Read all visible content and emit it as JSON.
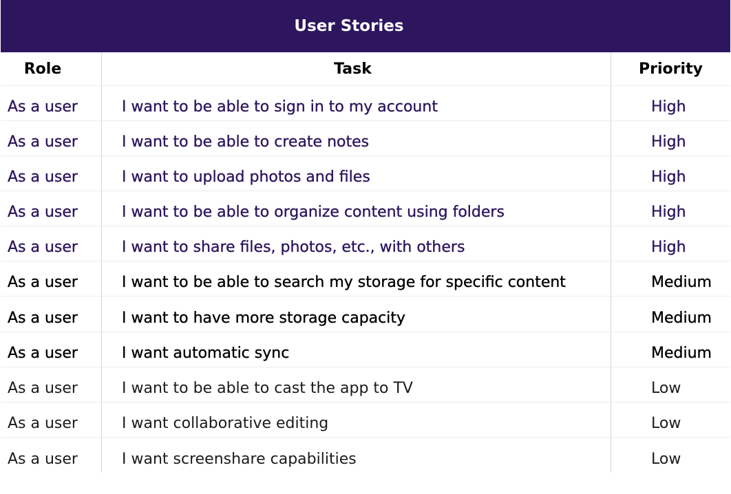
{
  "title": "User Stories",
  "columns": {
    "role": "Role",
    "task": "Task",
    "priority": "Priority"
  },
  "colors": {
    "title_bg": "#2d165e",
    "high_text": "#2d165e",
    "medium_text": "#000000",
    "low_text": "#1a1a1a"
  },
  "stories": [
    {
      "role": "As a user",
      "task": "I want to be able to sign in to my account",
      "priority": "High"
    },
    {
      "role": "As a user",
      "task": "I want to be able to create  notes",
      "priority": "High"
    },
    {
      "role": "As a user",
      "task": "I want to upload photos and files",
      "priority": "High"
    },
    {
      "role": "As a user",
      "task": "I want to be able to organize content using folders",
      "priority": "High"
    },
    {
      "role": "As a user",
      "task": "I want to share files, photos, etc.,  with others",
      "priority": "High"
    },
    {
      "role": "As a user",
      "task": "I want to be able to search my storage for specific content",
      "priority": "Medium"
    },
    {
      "role": "As a user",
      "task": "I want to have more storage capacity",
      "priority": "Medium"
    },
    {
      "role": "As a user",
      "task": "I want automatic sync",
      "priority": "Medium"
    },
    {
      "role": "As a user",
      "task": "I want to be able to cast the app to TV",
      "priority": "Low"
    },
    {
      "role": "As a user",
      "task": "I want collaborative editing",
      "priority": "Low"
    },
    {
      "role": "As a user",
      "task": "I want screenshare capabilities",
      "priority": "Low"
    }
  ]
}
